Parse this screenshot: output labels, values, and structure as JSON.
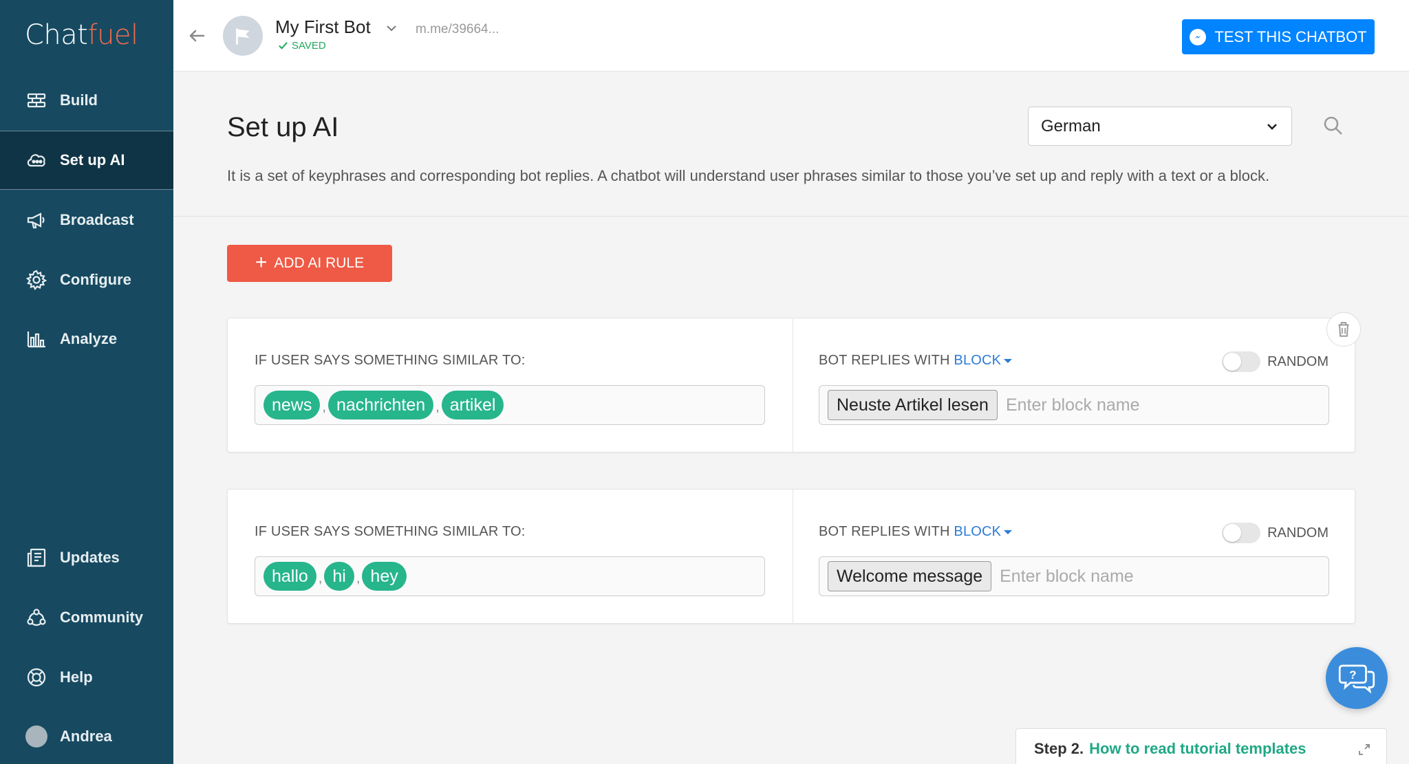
{
  "app": {
    "logo_part1": "Chat",
    "logo_part2": "fuel"
  },
  "sidebar": {
    "items": [
      {
        "label": "Build",
        "icon": "build-icon"
      },
      {
        "label": "Set up AI",
        "icon": "ai-icon",
        "active": true
      },
      {
        "label": "Broadcast",
        "icon": "megaphone-icon"
      },
      {
        "label": "Configure",
        "icon": "gear-icon"
      },
      {
        "label": "Analyze",
        "icon": "bar-chart-icon"
      }
    ],
    "bottom_items": [
      {
        "label": "Updates",
        "icon": "updates-icon"
      },
      {
        "label": "Community",
        "icon": "community-icon"
      },
      {
        "label": "Help",
        "icon": "lifebuoy-icon"
      },
      {
        "label": "Andrea",
        "icon": "avatar"
      }
    ]
  },
  "topbar": {
    "bot_name": "My First Bot",
    "bot_url": "m.me/39664...",
    "saved_label": "SAVED",
    "test_button": "TEST THIS CHATBOT"
  },
  "page": {
    "title": "Set up AI",
    "language": "German",
    "description": "It is a set of keyphrases and corresponding bot replies. A chatbot will understand user phrases similar to those you’ve set up and reply with a text or a block.",
    "add_rule_label": "ADD AI RULE"
  },
  "rules": [
    {
      "if_label": "IF USER SAYS SOMETHING SIMILAR TO:",
      "phrases": [
        "news",
        "nachrichten",
        "artikel"
      ],
      "reply_label": "BOT REPLIES WITH",
      "reply_type": "BLOCK",
      "random_label": "RANDOM",
      "random_on": false,
      "block": "Neuste Artikel lesen",
      "block_placeholder": "Enter block name"
    },
    {
      "if_label": "IF USER SAYS SOMETHING SIMILAR TO:",
      "phrases": [
        "hallo",
        "hi",
        "hey"
      ],
      "reply_label": "BOT REPLIES WITH",
      "reply_type": "BLOCK",
      "random_label": "RANDOM",
      "random_on": false,
      "block": "Welcome message",
      "block_placeholder": "Enter block name"
    }
  ],
  "separator": ",",
  "tutorial": {
    "step": "Step 2.",
    "link": "How to read tutorial templates"
  },
  "colors": {
    "sidebar": "#174a61",
    "accent": "#ee5a45",
    "tag": "#27b58c",
    "messenger": "#0084ff"
  }
}
